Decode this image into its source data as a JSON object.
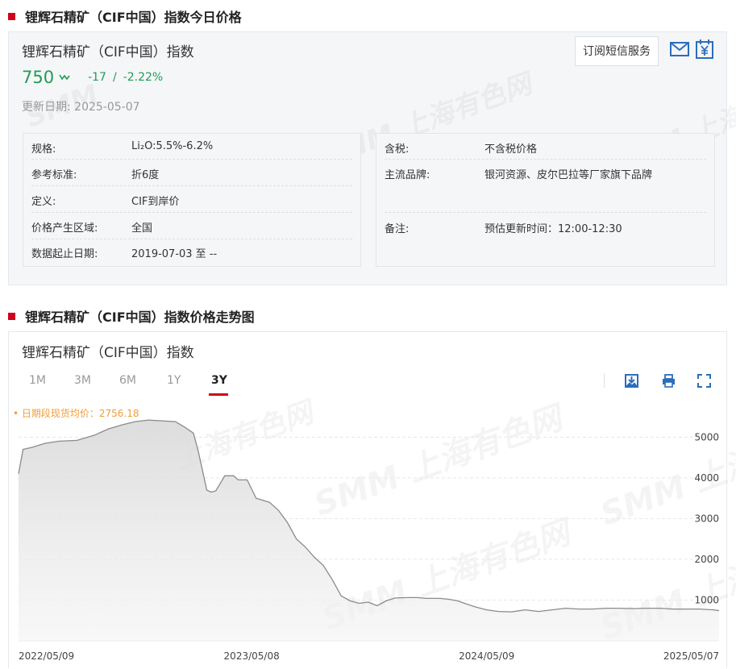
{
  "section1": {
    "title": "锂辉石精矿（CIF中国）指数今日价格"
  },
  "summary": {
    "name": "锂辉石精矿（CIF中国）指数",
    "price": "750",
    "change": "-17",
    "separator": "/",
    "change_pct": "-2.22%",
    "update_label": "更新日期:",
    "update_date": "2025-05-07",
    "subscribe_label": "订阅短信服务",
    "icons": [
      "mail-icon",
      "yen-icon",
      "trend-down-icon"
    ]
  },
  "info_left": [
    {
      "key": "规格:",
      "value": "Li₂O:5.5%-6.2%"
    },
    {
      "key": "参考标准:",
      "value": "折6度"
    },
    {
      "key": "定义:",
      "value": "CIF到岸价"
    },
    {
      "key": "价格产生区域:",
      "value": "全国"
    },
    {
      "key": "数据起止日期:",
      "value": "2019-07-03 至 --"
    }
  ],
  "info_right": [
    {
      "key": "含税:",
      "value": "不含税价格"
    },
    {
      "key": "主流品牌:",
      "value": "银河资源、皮尔巴拉等厂家旗下品牌"
    },
    {
      "key": "备注:",
      "value": "预估更新时间：12:00-12:30"
    }
  ],
  "section2": {
    "title": "锂辉石精矿（CIF中国）指数价格走势图"
  },
  "chart_panel": {
    "title": "锂辉石精矿（CIF中国）指数",
    "tabs": [
      "1M",
      "3M",
      "6M",
      "1Y",
      "3Y"
    ],
    "active_tab": "3Y",
    "tools": [
      "download-image-icon",
      "print-icon",
      "fullscreen-icon"
    ],
    "avg_label": "• 日期段现货均价：2756.18"
  },
  "watermark": {
    "brand": "SMM",
    "cn": "上海有色网"
  },
  "colors": {
    "accent_red": "#d0021b",
    "down_green": "#1f9d55",
    "avg_orange": "#f29c38",
    "line": "#8a8a8a"
  },
  "chart_data": {
    "type": "area",
    "xlabel": "",
    "ylabel": "",
    "x_ticks": [
      "2022/05/09",
      "2023/05/08",
      "2024/05/09",
      "2025/05/07"
    ],
    "y_ticks": [
      1000,
      2000,
      3000,
      4000,
      5000
    ],
    "ylim": [
      0,
      5600
    ],
    "xlim": [
      "2022-05-09",
      "2025-05-07"
    ],
    "grid": true,
    "series": [
      {
        "x": [
          "2022-05-09",
          "2022-05-16",
          "2022-05-30",
          "2022-06-20",
          "2022-07-11",
          "2022-08-08",
          "2022-09-05",
          "2022-09-26",
          "2022-10-17",
          "2022-11-07",
          "2022-11-28",
          "2022-12-19",
          "2023-01-09",
          "2023-01-23",
          "2023-02-06",
          "2023-02-13",
          "2023-02-20",
          "2023-02-27",
          "2023-03-06",
          "2023-03-13",
          "2023-03-27",
          "2023-04-10",
          "2023-04-17",
          "2023-05-01",
          "2023-05-15",
          "2023-06-05",
          "2023-06-19",
          "2023-07-03",
          "2023-07-17",
          "2023-07-31",
          "2023-08-14",
          "2023-08-28",
          "2023-09-11",
          "2023-09-25",
          "2023-10-09",
          "2023-10-23",
          "2023-11-06",
          "2023-11-20",
          "2023-12-04",
          "2023-12-18",
          "2024-01-08",
          "2024-01-22",
          "2024-02-05",
          "2024-02-26",
          "2024-03-11",
          "2024-03-25",
          "2024-04-08",
          "2024-04-22",
          "2024-05-09",
          "2024-05-27",
          "2024-06-17",
          "2024-07-08",
          "2024-07-29",
          "2024-08-19",
          "2024-09-09",
          "2024-09-30",
          "2024-10-21",
          "2024-11-11",
          "2024-12-02",
          "2024-12-23",
          "2025-01-13",
          "2025-02-03",
          "2025-02-24",
          "2025-03-17",
          "2025-04-07",
          "2025-04-28",
          "2025-05-07"
        ],
        "values": [
          4100,
          4700,
          4750,
          4850,
          4900,
          4920,
          5050,
          5200,
          5300,
          5380,
          5420,
          5400,
          5380,
          5250,
          5100,
          4700,
          4200,
          3700,
          3650,
          3680,
          4050,
          4050,
          3950,
          3950,
          3500,
          3400,
          3200,
          2900,
          2500,
          2300,
          2050,
          1850,
          1500,
          1100,
          980,
          920,
          950,
          860,
          980,
          1050,
          1060,
          1060,
          1040,
          1040,
          1020,
          980,
          900,
          830,
          760,
          720,
          710,
          760,
          720,
          760,
          800,
          780,
          780,
          800,
          800,
          790,
          800,
          800,
          780,
          780,
          780,
          760,
          740
        ]
      }
    ]
  }
}
